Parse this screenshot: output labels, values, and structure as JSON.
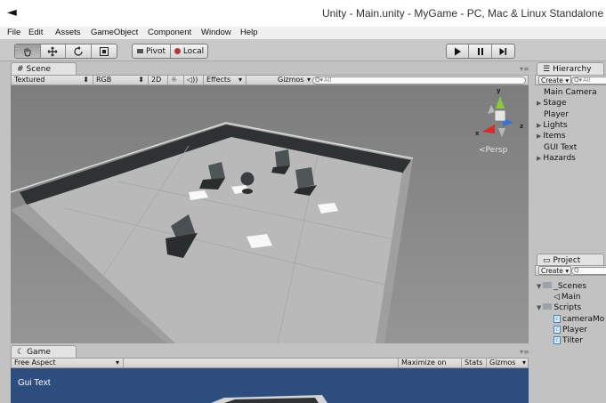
{
  "window": {
    "title": "Unity - Main.unity - MyGame - PC, Mac & Linux Standalone <D",
    "logo_glyph": "◄"
  },
  "menu": [
    "File",
    "Edit",
    "Assets",
    "GameObject",
    "Component",
    "Window",
    "Help"
  ],
  "toolbar": {
    "pivot_label": "Pivot",
    "local_label": "Local"
  },
  "scene": {
    "tab_label": "Scene",
    "render_mode": "Textured",
    "color_mode": "RGB",
    "mode_2d": "2D",
    "effects_label": "Effects",
    "gizmos_label": "Gizmos",
    "search_placeholder": "All",
    "gizmo": {
      "x_label": "x",
      "y_label": "y",
      "z_label": "z",
      "persp_label": "Persp"
    }
  },
  "game": {
    "tab_label": "Game",
    "aspect": "Free Aspect",
    "maximize_label": "Maximize on Play",
    "stats_label": "Stats",
    "gizmos_label": "Gizmos",
    "gui_text": "Gui Text"
  },
  "hierarchy": {
    "tab_label": "Hierarchy",
    "create_label": "Create",
    "search_placeholder": "All",
    "items": [
      {
        "label": "Main Camera",
        "expandable": false
      },
      {
        "label": "Stage",
        "expandable": true
      },
      {
        "label": "Player",
        "expandable": false
      },
      {
        "label": "Lights",
        "expandable": true
      },
      {
        "label": "Items",
        "expandable": true
      },
      {
        "label": "GUI Text",
        "expandable": false
      },
      {
        "label": "Hazards",
        "expandable": true
      }
    ]
  },
  "project": {
    "tab_label": "Project",
    "create_label": "Create",
    "folders": [
      {
        "label": "_Scenes",
        "children": [
          "Main"
        ]
      },
      {
        "label": "Scripts",
        "children": [
          "cameraMo",
          "Player",
          "Tilter"
        ]
      }
    ]
  },
  "colors": {
    "game_background": "#2e4d7f",
    "scene_sky": "#8a8a8a",
    "floor": "#b9b9b9",
    "gizmo_x": "#d62b2b",
    "gizmo_y": "#8cc83c",
    "gizmo_z": "#3a72d8"
  }
}
